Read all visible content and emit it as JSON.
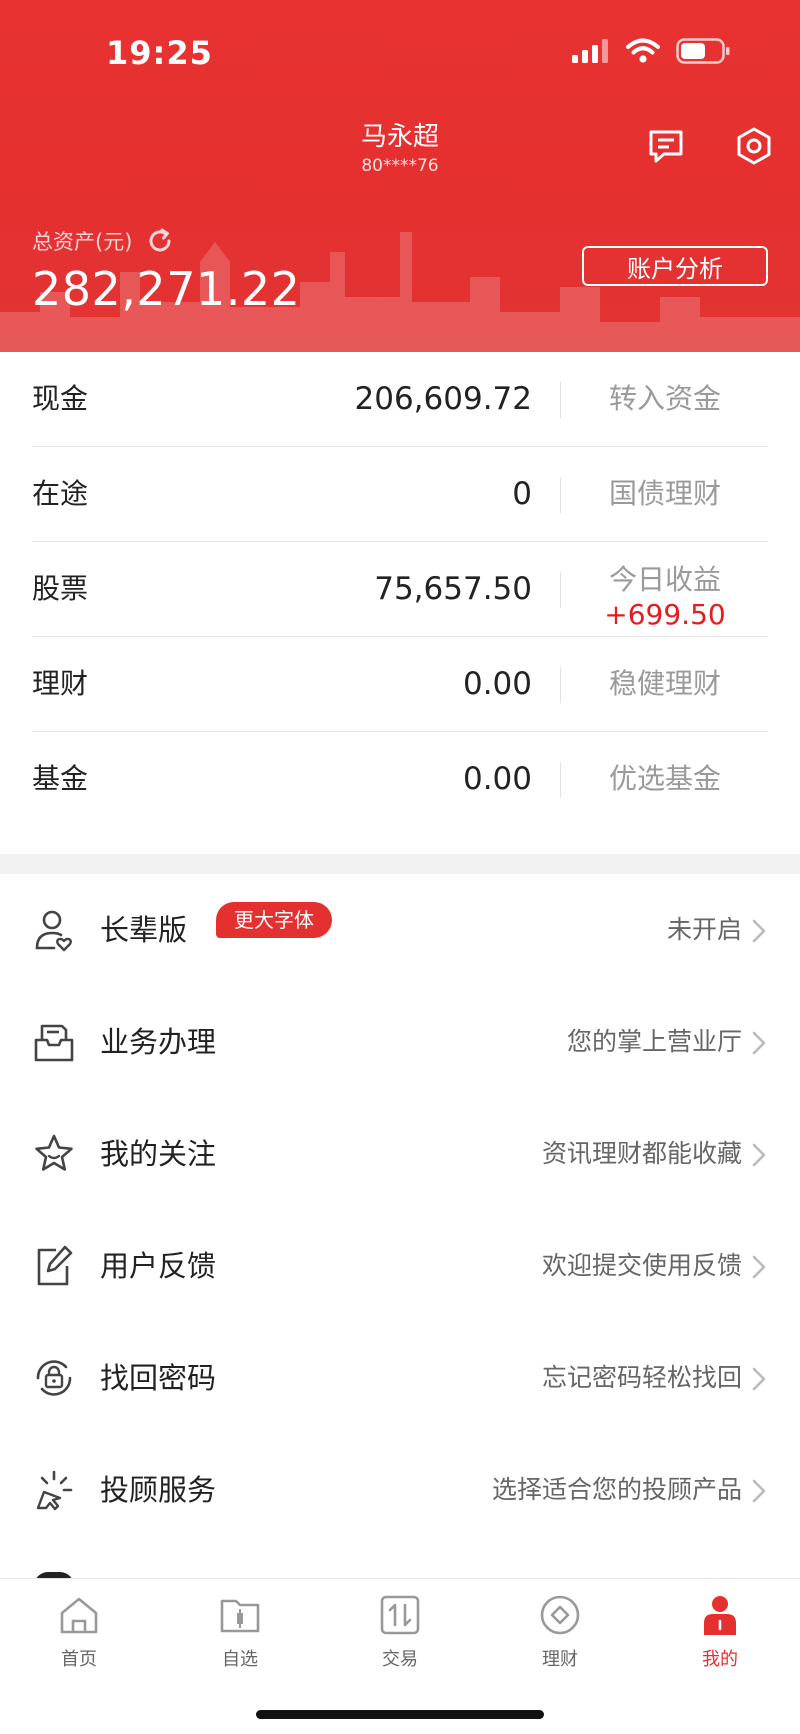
{
  "status_bar": {
    "time": "19:25"
  },
  "header": {
    "user_name": "马永超",
    "user_id": "80****76",
    "assets_label": "总资产(元)",
    "total_assets": "282,271.22",
    "analysis_button": "账户分析"
  },
  "assets": [
    {
      "name": "现金",
      "value": "206,609.72",
      "action": "转入资金"
    },
    {
      "name": "在途",
      "value": "0",
      "action": "国债理财"
    },
    {
      "name": "股票",
      "value": "75,657.50",
      "action": "今日收益",
      "profit": "+699.50"
    },
    {
      "name": "理财",
      "value": "0.00",
      "action": "稳健理财"
    },
    {
      "name": "基金",
      "value": "0.00",
      "action": "优选基金"
    }
  ],
  "menu": [
    {
      "label": "长辈版",
      "badge": "更大字体",
      "desc": "未开启",
      "icon": "user-heart-icon"
    },
    {
      "label": "业务办理",
      "desc": "您的掌上营业厅",
      "icon": "inbox-icon"
    },
    {
      "label": "我的关注",
      "desc": "资讯理财都能收藏",
      "icon": "star-icon"
    },
    {
      "label": "用户反馈",
      "desc": "欢迎提交使用反馈",
      "icon": "edit-icon"
    },
    {
      "label": "找回密码",
      "desc": "忘记密码轻松找回",
      "icon": "lock-refresh-icon"
    },
    {
      "label": "投顾服务",
      "desc": "选择适合您的投顾产品",
      "icon": "cursor-click-icon"
    }
  ],
  "tabs": [
    {
      "label": "首页",
      "icon": "home-icon"
    },
    {
      "label": "自选",
      "icon": "folder-chart-icon"
    },
    {
      "label": "交易",
      "icon": "trade-icon"
    },
    {
      "label": "理财",
      "icon": "diamond-circle-icon"
    },
    {
      "label": "我的",
      "icon": "person-icon",
      "active": true
    }
  ],
  "colors": {
    "brand_red": "#e53030",
    "profit_red": "#e02020"
  }
}
